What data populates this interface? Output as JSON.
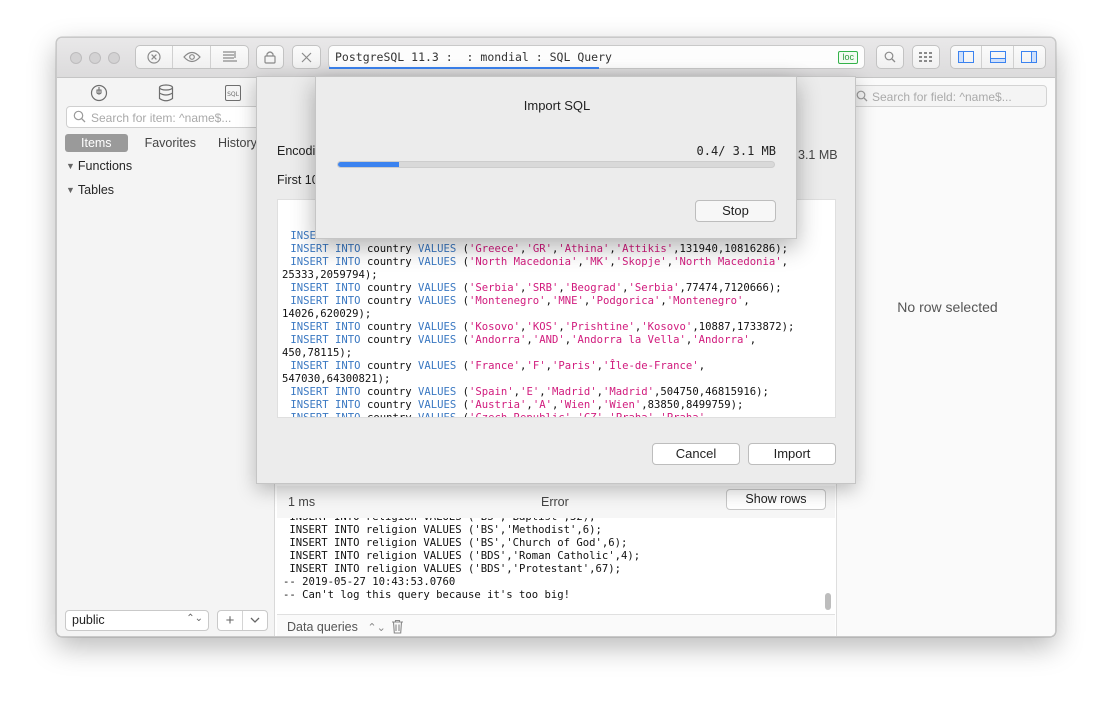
{
  "toolbar": {
    "address": "PostgreSQL 11.3 :  : mondial : SQL Query",
    "badge": "loc"
  },
  "sidebar": {
    "search_placeholder": "Search for item: ^name$...",
    "tabs": [
      "Items",
      "Favorites",
      "History"
    ],
    "tree": [
      "Functions",
      "Tables"
    ],
    "schema": "public"
  },
  "right_panel": {
    "search_placeholder": "Search for field: ^name$...",
    "empty": "No row selected"
  },
  "result": {
    "time": "1 ms",
    "status": "Error",
    "show_rows": "Show rows"
  },
  "log_lines": [
    " INSERT INTO religion VALUES ('BS','Methodist',6);",
    " INSERT INTO religion VALUES ('BS','Church of God',6);",
    " INSERT INTO religion VALUES ('BDS','Roman Catholic',4);",
    " INSERT INTO religion VALUES ('BDS','Protestant',67);",
    "",
    "-- 2019-05-27 10:43:53.0760",
    "-- Can't log this query because it's too big!"
  ],
  "footer": {
    "filter": "Data queries"
  },
  "import_sheet": {
    "encoding_label": "Encodi",
    "first_label": "First 10",
    "file_size": "3.1 MB",
    "cancel": "Cancel",
    "import": "Import",
    "preview_lines": [
      [
        {
          "t": "INSER",
          "c": "kw"
        }
      ],
      [
        {
          "t": "INSERT INTO",
          "c": "kw"
        },
        {
          "t": " country "
        },
        {
          "t": "VALUES",
          "c": "kw"
        },
        {
          "t": " ("
        },
        {
          "t": "'Greece'",
          "c": "str"
        },
        {
          "t": ","
        },
        {
          "t": "'GR'",
          "c": "str"
        },
        {
          "t": ","
        },
        {
          "t": "'Athina'",
          "c": "str"
        },
        {
          "t": ","
        },
        {
          "t": "'Attikis'",
          "c": "str"
        },
        {
          "t": ",131940,10816286);"
        }
      ],
      [
        {
          "t": "INSERT INTO",
          "c": "kw"
        },
        {
          "t": " country "
        },
        {
          "t": "VALUES",
          "c": "kw"
        },
        {
          "t": " ("
        },
        {
          "t": "'North Macedonia'",
          "c": "str"
        },
        {
          "t": ","
        },
        {
          "t": "'MK'",
          "c": "str"
        },
        {
          "t": ","
        },
        {
          "t": "'Skopje'",
          "c": "str"
        },
        {
          "t": ","
        },
        {
          "t": "'North Macedonia'",
          "c": "str"
        },
        {
          "t": ","
        }
      ],
      [
        {
          "t": "25333,2059794);",
          "c": "cont"
        }
      ],
      [
        {
          "t": "INSERT INTO",
          "c": "kw"
        },
        {
          "t": " country "
        },
        {
          "t": "VALUES",
          "c": "kw"
        },
        {
          "t": " ("
        },
        {
          "t": "'Serbia'",
          "c": "str"
        },
        {
          "t": ","
        },
        {
          "t": "'SRB'",
          "c": "str"
        },
        {
          "t": ","
        },
        {
          "t": "'Beograd'",
          "c": "str"
        },
        {
          "t": ","
        },
        {
          "t": "'Serbia'",
          "c": "str"
        },
        {
          "t": ",77474,7120666);"
        }
      ],
      [
        {
          "t": "INSERT INTO",
          "c": "kw"
        },
        {
          "t": " country "
        },
        {
          "t": "VALUES",
          "c": "kw"
        },
        {
          "t": " ("
        },
        {
          "t": "'Montenegro'",
          "c": "str"
        },
        {
          "t": ","
        },
        {
          "t": "'MNE'",
          "c": "str"
        },
        {
          "t": ","
        },
        {
          "t": "'Podgorica'",
          "c": "str"
        },
        {
          "t": ","
        },
        {
          "t": "'Montenegro'",
          "c": "str"
        },
        {
          "t": ","
        }
      ],
      [
        {
          "t": "14026,620029);",
          "c": "cont"
        }
      ],
      [
        {
          "t": "INSERT INTO",
          "c": "kw"
        },
        {
          "t": " country "
        },
        {
          "t": "VALUES",
          "c": "kw"
        },
        {
          "t": " ("
        },
        {
          "t": "'Kosovo'",
          "c": "str"
        },
        {
          "t": ","
        },
        {
          "t": "'KOS'",
          "c": "str"
        },
        {
          "t": ","
        },
        {
          "t": "'Prishtine'",
          "c": "str"
        },
        {
          "t": ","
        },
        {
          "t": "'Kosovo'",
          "c": "str"
        },
        {
          "t": ",10887,1733872);"
        }
      ],
      [
        {
          "t": "INSERT INTO",
          "c": "kw"
        },
        {
          "t": " country "
        },
        {
          "t": "VALUES",
          "c": "kw"
        },
        {
          "t": " ("
        },
        {
          "t": "'Andorra'",
          "c": "str"
        },
        {
          "t": ","
        },
        {
          "t": "'AND'",
          "c": "str"
        },
        {
          "t": ","
        },
        {
          "t": "'Andorra la Vella'",
          "c": "str"
        },
        {
          "t": ","
        },
        {
          "t": "'Andorra'",
          "c": "str"
        },
        {
          "t": ","
        }
      ],
      [
        {
          "t": "450,78115);",
          "c": "cont"
        }
      ],
      [
        {
          "t": "INSERT INTO",
          "c": "kw"
        },
        {
          "t": " country "
        },
        {
          "t": "VALUES",
          "c": "kw"
        },
        {
          "t": " ("
        },
        {
          "t": "'France'",
          "c": "str"
        },
        {
          "t": ","
        },
        {
          "t": "'F'",
          "c": "str"
        },
        {
          "t": ","
        },
        {
          "t": "'Paris'",
          "c": "str"
        },
        {
          "t": ","
        },
        {
          "t": "'Île-de-France'",
          "c": "str"
        },
        {
          "t": ","
        }
      ],
      [
        {
          "t": "547030,64300821);",
          "c": "cont"
        }
      ],
      [
        {
          "t": "INSERT INTO",
          "c": "kw"
        },
        {
          "t": " country "
        },
        {
          "t": "VALUES",
          "c": "kw"
        },
        {
          "t": " ("
        },
        {
          "t": "'Spain'",
          "c": "str"
        },
        {
          "t": ","
        },
        {
          "t": "'E'",
          "c": "str"
        },
        {
          "t": ","
        },
        {
          "t": "'Madrid'",
          "c": "str"
        },
        {
          "t": ","
        },
        {
          "t": "'Madrid'",
          "c": "str"
        },
        {
          "t": ",504750,46815916);"
        }
      ],
      [
        {
          "t": "INSERT INTO",
          "c": "kw"
        },
        {
          "t": " country "
        },
        {
          "t": "VALUES",
          "c": "kw"
        },
        {
          "t": " ("
        },
        {
          "t": "'Austria'",
          "c": "str"
        },
        {
          "t": ","
        },
        {
          "t": "'A'",
          "c": "str"
        },
        {
          "t": ","
        },
        {
          "t": "'Wien'",
          "c": "str"
        },
        {
          "t": ","
        },
        {
          "t": "'Wien'",
          "c": "str"
        },
        {
          "t": ",83850,8499759);"
        }
      ],
      [
        {
          "t": "INSERT INTO",
          "c": "kw"
        },
        {
          "t": " country "
        },
        {
          "t": "VALUES",
          "c": "kw"
        },
        {
          "t": " ("
        },
        {
          "t": "'Czech Republic'",
          "c": "str"
        },
        {
          "t": ","
        },
        {
          "t": "'CZ'",
          "c": "str"
        },
        {
          "t": ","
        },
        {
          "t": "'Praha'",
          "c": "str"
        },
        {
          "t": ","
        },
        {
          "t": "'Praha'",
          "c": "str"
        },
        {
          "t": ","
        }
      ]
    ]
  },
  "progress_sheet": {
    "title": "Import SQL",
    "amount": "0.4/ 3.1 MB",
    "fraction": 0.14,
    "stop": "Stop",
    "accent": "#3b83f0"
  }
}
